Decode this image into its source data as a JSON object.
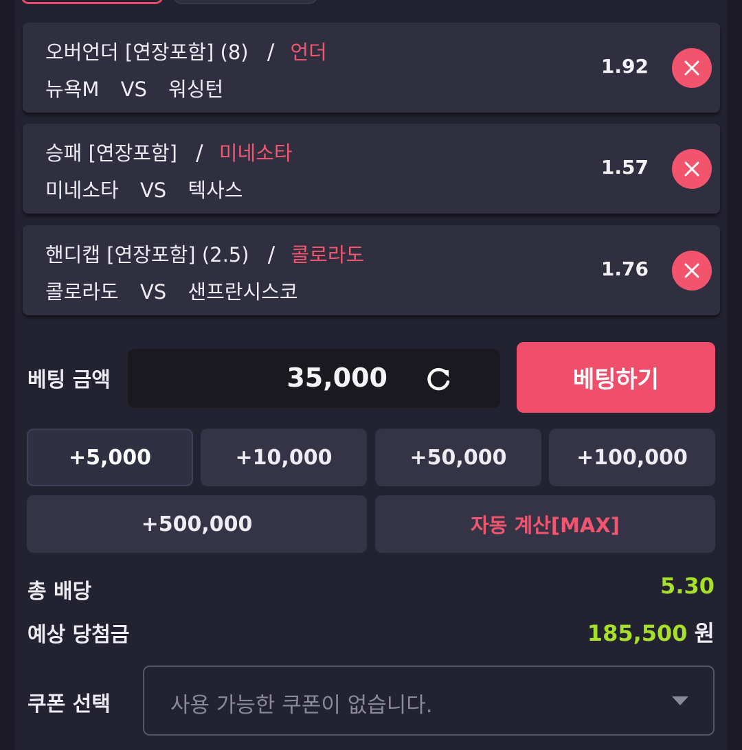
{
  "bets": [
    {
      "market": "오버언더 [연장포함]",
      "param": "(8)",
      "pick": "언더",
      "home": "뉴욕M",
      "vs": "VS",
      "away": "워싱턴",
      "odds": "1.92"
    },
    {
      "market": "승패 [연장포함]",
      "param": "",
      "pick": "미네소타",
      "home": "미네소타",
      "vs": "VS",
      "away": "텍사스",
      "odds": "1.57"
    },
    {
      "market": "핸디캡 [연장포함]",
      "param": "(2.5)",
      "pick": "콜로라도",
      "home": "콜로라도",
      "vs": "VS",
      "away": "샌프란시스코",
      "odds": "1.76"
    }
  ],
  "bet_amount": {
    "label": "베팅 금액",
    "value": "35,000"
  },
  "bet_button": "베팅하기",
  "quick_amounts": [
    "+5,000",
    "+10,000",
    "+50,000",
    "+100,000",
    "+500,000"
  ],
  "auto_calc": "자동 계산[MAX]",
  "summary": {
    "total_odds_label": "총 배당",
    "total_odds": "5.30",
    "expected_win_label": "예상 당첨금",
    "expected_win": "185,500",
    "currency": "원"
  },
  "coupon": {
    "label": "쿠폰 선택",
    "placeholder": "사용 가능한 쿠폰이 없습니다."
  },
  "colors": {
    "accent": "#ef4e6b",
    "value_green": "#a6e02a",
    "panel": "#232230",
    "card": "#302f40"
  },
  "icons": {
    "remove": "close-icon",
    "refresh": "refresh-icon",
    "dropdown": "chevron-down-icon"
  }
}
